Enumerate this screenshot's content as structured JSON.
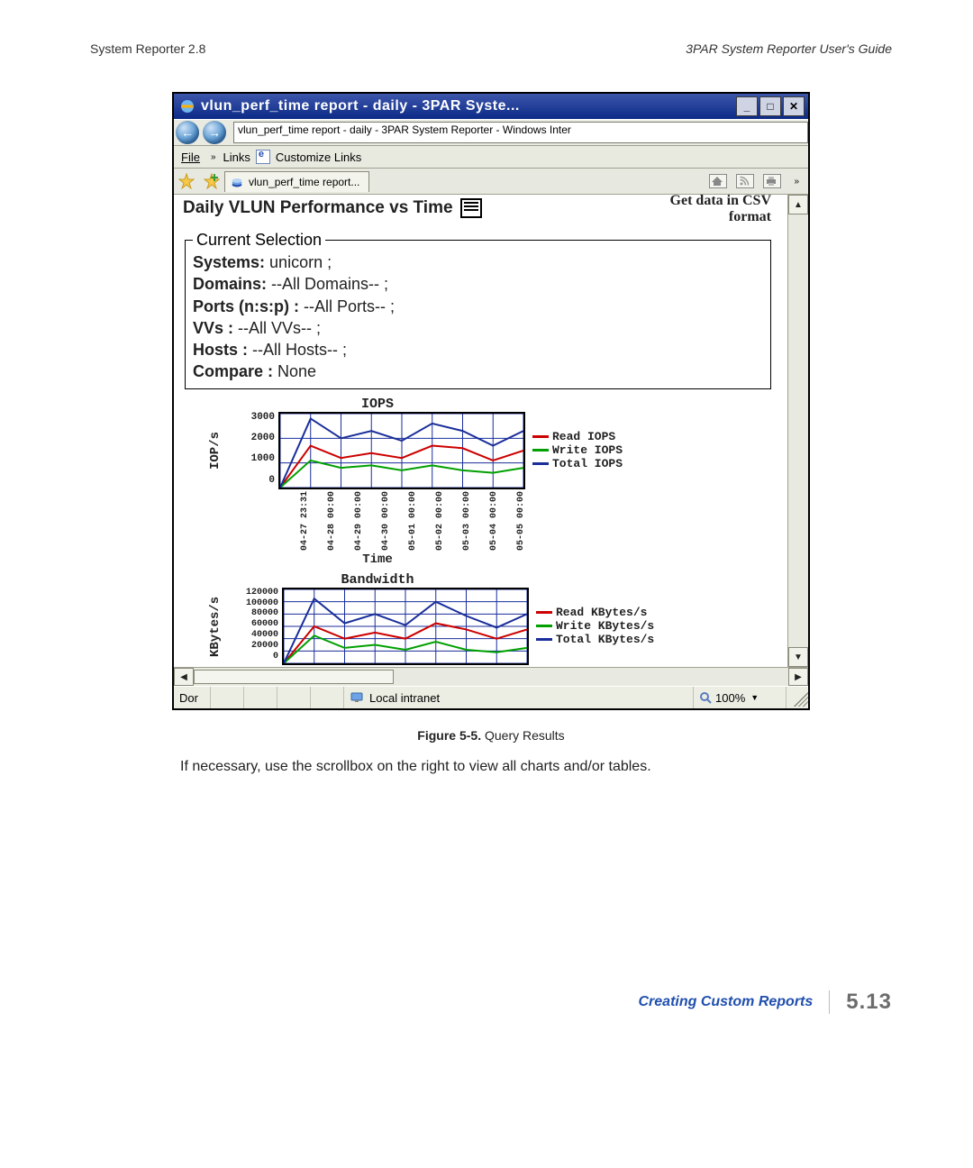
{
  "doc": {
    "header_left": "System Reporter 2.8",
    "header_right": "3PAR System Reporter User's Guide",
    "caption_strong": "Figure 5-5.",
    "caption_rest": "  Query Results",
    "body_text": "If necessary, use the scrollbox on the right to view all charts and/or tables.",
    "footer_section": "Creating Custom Reports",
    "footer_page": "5.13"
  },
  "window": {
    "title": "vlun_perf_time report - daily - 3PAR Syste...",
    "address": "vlun_perf_time report - daily - 3PAR System Reporter - Windows Inter",
    "menu_file": "File",
    "menu_links": "Links",
    "menu_customize": "Customize Links",
    "tab_label": "vlun_perf_time report...",
    "status_left": "Dor",
    "status_zone": "Local intranet",
    "status_zoom": "100%"
  },
  "report": {
    "title": "Daily VLUN Performance vs Time",
    "csv_link_l1": "Get data in CSV",
    "csv_link_l2": "format",
    "selection_legend": "Current Selection",
    "sel": {
      "systems_k": "Systems:",
      "systems_v": " unicorn ;",
      "domains_k": "Domains:",
      "domains_v": " --All Domains-- ;",
      "ports_k": "Ports (n:s:p) :",
      "ports_v": " --All Ports-- ;",
      "vvs_k": "VVs :",
      "vvs_v": " --All VVs-- ;",
      "hosts_k": "Hosts :",
      "hosts_v": " --All Hosts-- ;",
      "compare_k": "Compare :",
      "compare_v": " None"
    }
  },
  "chart_data": [
    {
      "type": "line",
      "title": "IOPS",
      "xlabel": "Time",
      "ylabel": "IOP/s",
      "ylim": [
        0,
        3000
      ],
      "yticks": [
        3000,
        2000,
        1000,
        0
      ],
      "categories": [
        "04-27 23:31",
        "04-28 00:00",
        "04-29 00:00",
        "04-30 00:00",
        "05-01 00:00",
        "05-02 00:00",
        "05-03 00:00",
        "05-04 00:00",
        "05-05 00:00"
      ],
      "series": [
        {
          "name": "Read IOPS",
          "color": "#cc0000",
          "values": [
            0,
            1700,
            1200,
            1400,
            1200,
            1700,
            1600,
            1100,
            1500
          ]
        },
        {
          "name": "Write IOPS",
          "color": "#00a000",
          "values": [
            0,
            1100,
            800,
            900,
            700,
            900,
            700,
            600,
            800
          ]
        },
        {
          "name": "Total IOPS",
          "color": "#1a2e9a",
          "values": [
            0,
            2800,
            2000,
            2300,
            1900,
            2600,
            2300,
            1700,
            2300
          ]
        }
      ]
    },
    {
      "type": "line",
      "title": "Bandwidth",
      "xlabel": "Time",
      "ylabel": "KBytes/s",
      "ylim": [
        0,
        120000
      ],
      "yticks": [
        120000,
        100000,
        80000,
        60000,
        40000,
        20000,
        0
      ],
      "categories": [
        "04-27 23:31",
        "04-28 00:00",
        "04-29 00:00",
        "04-30 00:00",
        "05-01 00:00",
        "05-02 00:00",
        "05-03 00:00",
        "05-04 00:00",
        "05-05 00:00"
      ],
      "series": [
        {
          "name": "Read KBytes/s",
          "color": "#cc0000",
          "values": [
            0,
            60000,
            40000,
            50000,
            40000,
            65000,
            55000,
            40000,
            55000
          ]
        },
        {
          "name": "Write KBytes/s",
          "color": "#00a000",
          "values": [
            0,
            45000,
            25000,
            30000,
            22000,
            35000,
            22000,
            18000,
            25000
          ]
        },
        {
          "name": "Total KBytes/s",
          "color": "#1a2e9a",
          "values": [
            0,
            105000,
            65000,
            80000,
            62000,
            100000,
            77000,
            58000,
            80000
          ]
        }
      ]
    }
  ]
}
